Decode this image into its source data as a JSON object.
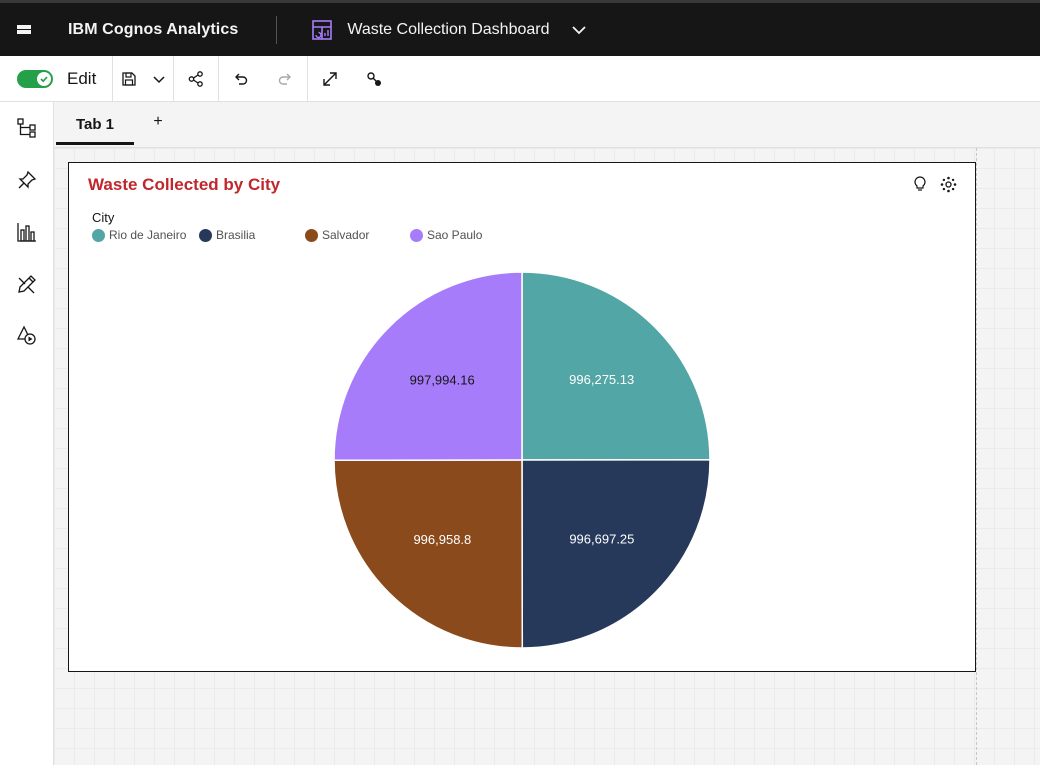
{
  "header": {
    "brand": "IBM Cognos Analytics",
    "dashboard_title": "Waste Collection Dashboard",
    "dashboard_icon": "dashboard-icon",
    "menu_icon": "hamburger-menu-icon",
    "dropdown_icon": "chevron-down-icon"
  },
  "toolbar": {
    "edit_label": "Edit",
    "edit_enabled": true,
    "buttons": [
      "save-icon",
      "chevron-down-icon",
      "share-icon",
      "undo-icon",
      "redo-icon",
      "expand-icon",
      "filter-icon"
    ]
  },
  "sidebar": {
    "items": [
      "data-tree-icon",
      "pin-icon",
      "visualizations-icon",
      "edit-tools-icon",
      "shapes-media-icon"
    ]
  },
  "tabs": {
    "items": [
      {
        "label": "Tab 1"
      }
    ],
    "add_label": "+"
  },
  "widget": {
    "title": "Waste Collected by City",
    "title_color": "#c0272d",
    "icons": [
      "lightbulb-icon",
      "settings-icon"
    ]
  },
  "chart_data": {
    "type": "pie",
    "legend_title": "City",
    "legend_position": "top-left",
    "slices": [
      {
        "label": "Rio de Janeiro",
        "value": 996275.13,
        "display": "996,275.13",
        "color": "#52a7a6"
      },
      {
        "label": "Brasilia",
        "value": 996697.25,
        "display": "996,697.25",
        "color": "#26395b"
      },
      {
        "label": "Salvador",
        "value": 996958.8,
        "display": "996,958.8",
        "color": "#8b4a1c"
      },
      {
        "label": "Sao Paulo",
        "value": 997994.16,
        "display": "997,994.16",
        "color": "#a77cfb"
      }
    ]
  }
}
